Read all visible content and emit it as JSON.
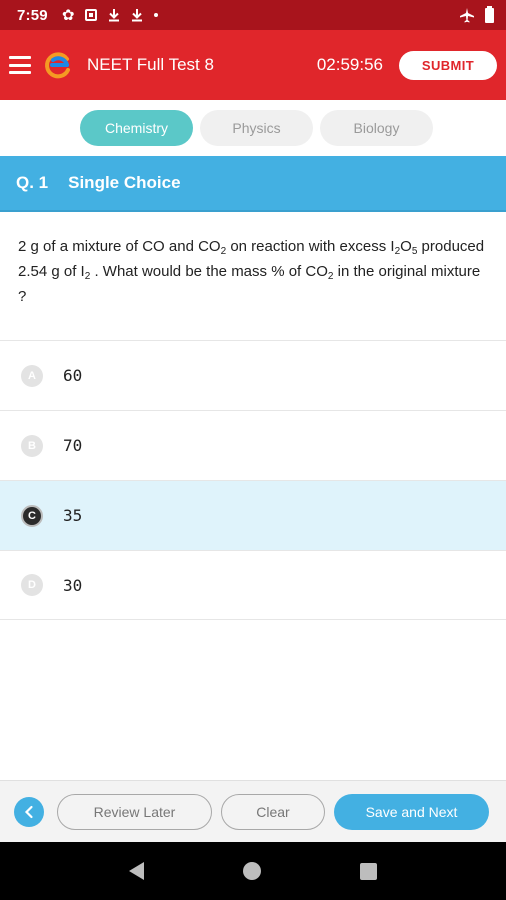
{
  "status_bar": {
    "time": "7:59",
    "icons": [
      "gear-icon",
      "notification-box-icon",
      "download-icon",
      "download-icon",
      "dot-icon",
      "airplane-icon",
      "battery-icon"
    ]
  },
  "app_bar": {
    "menu_icon": "hamburger-icon",
    "logo_icon": "app-logo-icon",
    "title": "NEET Full Test 8",
    "timer": "02:59:56",
    "submit_label": "SUBMIT"
  },
  "subject_tabs": [
    {
      "label": "Chemistry",
      "active": true
    },
    {
      "label": "Physics",
      "active": false
    },
    {
      "label": "Biology",
      "active": false
    }
  ],
  "question": {
    "number": "Q. 1",
    "type": "Single Choice",
    "text_parts": {
      "p1": "2 g of a mixture of CO and  CO",
      "s1": "2",
      "p2": " on reaction with excess I",
      "s2": "2",
      "p3": "O",
      "s3": "5",
      "p4": " produced 2.54 g of I",
      "s4": "2",
      "p5": " . What would be the mass % of CO",
      "s5": "2",
      "p6": " in the original mixture ?"
    }
  },
  "options": [
    {
      "letter": "A",
      "value": "60",
      "selected": false
    },
    {
      "letter": "B",
      "value": "70",
      "selected": false
    },
    {
      "letter": "C",
      "value": "35",
      "selected": true
    },
    {
      "letter": "D",
      "value": "30",
      "selected": false
    }
  ],
  "bottom_bar": {
    "back_icon": "chevron-left-icon",
    "review_label": "Review Later",
    "clear_label": "Clear",
    "save_label": "Save and Next"
  },
  "nav_bar": {
    "icons": [
      "nav-back-icon",
      "nav-home-icon",
      "nav-recents-icon"
    ]
  },
  "colors": {
    "status_bar": "#a8141c",
    "app_bar": "#e0262b",
    "active_tab": "#5bc8c8",
    "accent_blue": "#43b0e2",
    "selected_option_bg": "#dff3fb"
  }
}
